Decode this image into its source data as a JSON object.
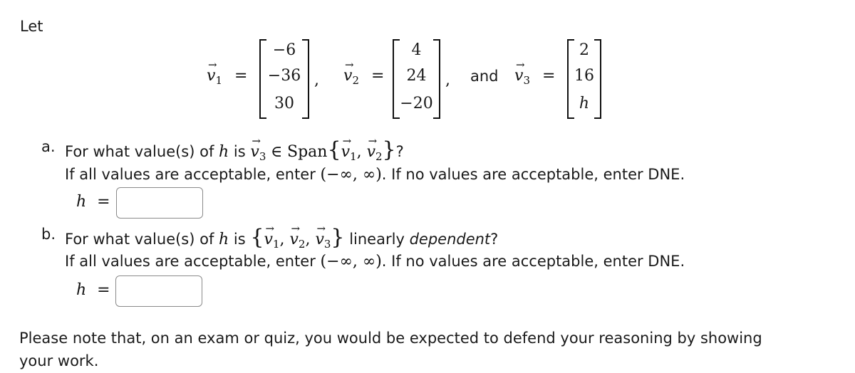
{
  "intro": "Let",
  "vectors": [
    {
      "name": "v",
      "index": "1",
      "equals": "=",
      "entries": [
        "−6",
        "−36",
        "30"
      ],
      "separator": ","
    },
    {
      "name": "v",
      "index": "2",
      "equals": "=",
      "entries": [
        "4",
        "24",
        "−20"
      ],
      "separator": ","
    },
    {
      "name": "v",
      "index": "3",
      "equals": "=",
      "entries": [
        "2",
        "16",
        "h"
      ],
      "separator": ""
    }
  ],
  "conjunction": "and",
  "part_a": {
    "label": "a.",
    "question_prefix": "For what value(s) of",
    "variable": "h",
    "question_is": "is",
    "member_symbol": "∈",
    "span_word": "Span",
    "question_suffix": "?",
    "instructions_prefix": "If all values are acceptable, enter",
    "interval": "(−∞, ∞)",
    "instructions_suffix": ". If no values are acceptable, enter DNE.",
    "answer_label": "h",
    "equals": "=",
    "answer_value": ""
  },
  "part_b": {
    "label": "b.",
    "question_prefix": "For what value(s) of",
    "variable": "h",
    "question_is": "is",
    "question_middle": "linearly",
    "question_emph": "dependent",
    "question_suffix": "?",
    "instructions_prefix": "If all values are acceptable, enter",
    "interval": "(−∞, ∞)",
    "instructions_suffix": ". If no values are acceptable, enter DNE.",
    "answer_label": "h",
    "equals": "=",
    "answer_value": ""
  },
  "note": {
    "line1": "Please note that, on an exam or quiz, you would be expected to defend your reasoning by showing",
    "line2": "your work."
  }
}
